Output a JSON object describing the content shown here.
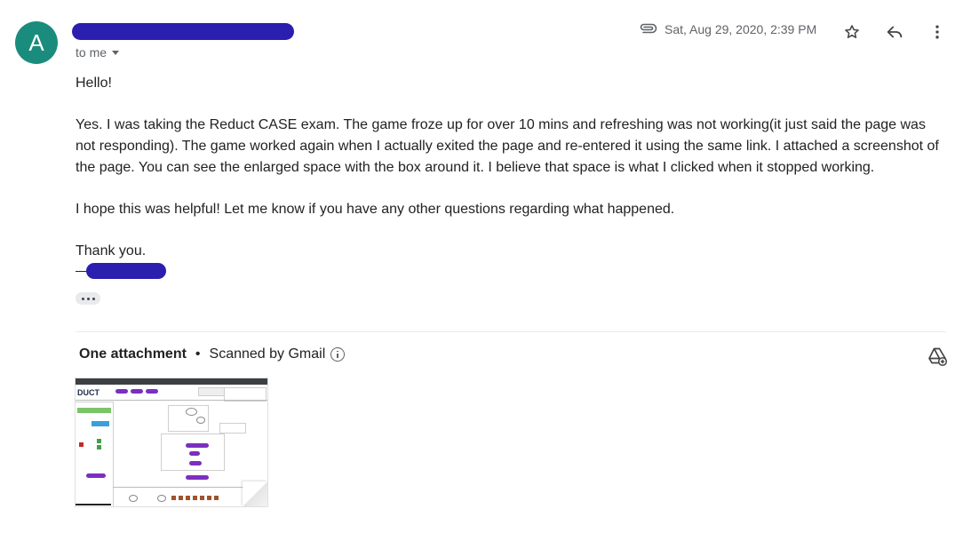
{
  "sender": {
    "avatar_letter": "A",
    "to_label": "to me"
  },
  "header": {
    "date": "Sat, Aug 29, 2020, 2:39 PM",
    "icons": [
      "paperclip-icon",
      "star-icon",
      "reply-icon",
      "more-vert-icon"
    ]
  },
  "body": {
    "greeting": "Hello!",
    "paragraph1": "Yes. I was taking the Reduct CASE exam. The game froze up for over 10 mins and refreshing was not working(it just said the page was not responding). The game worked again when I actually exited the page and re-entered it using the same link. I attached a screenshot of the page. You can see the enlarged space with the box around it. I believe that space is what I clicked when it stopped working.",
    "paragraph2": "I hope this was helpful! Let me know if you have any other questions regarding what happened.",
    "closing": "Thank you."
  },
  "attachments": {
    "count_label": "One attachment",
    "separator": "•",
    "scan_label": "Scanned by Gmail",
    "thumbnail_logo": "DUCT"
  },
  "colors": {
    "avatar_bg": "#1a8c7d",
    "redaction": "#2b1fb0",
    "muted_text": "#5f6368"
  }
}
